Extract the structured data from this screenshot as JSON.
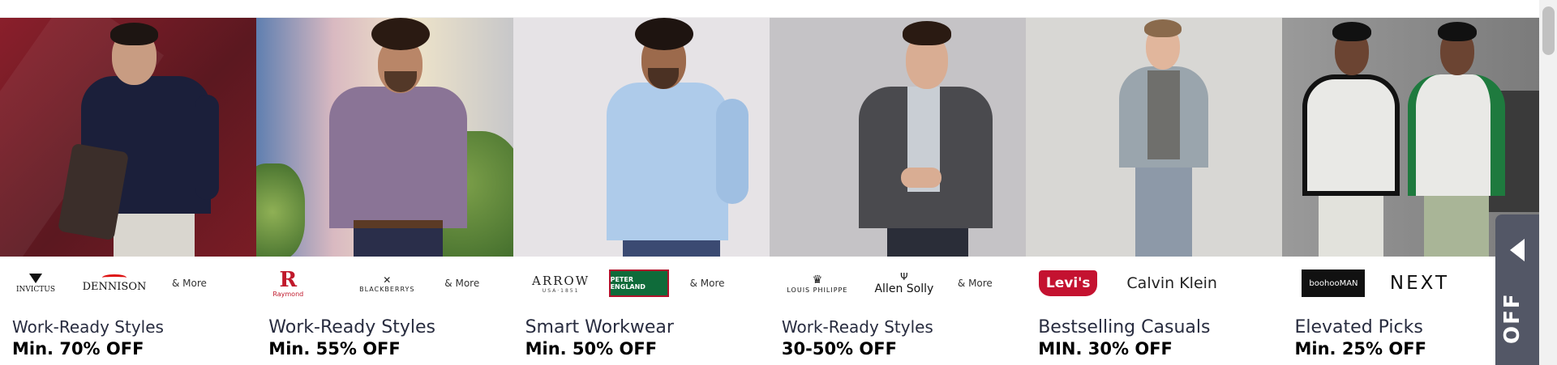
{
  "cards": [
    {
      "title": "Work-Ready Styles",
      "offer": "Min. 70% OFF",
      "brands": [
        "INVICTUS",
        "DENNISON"
      ],
      "more": "& More",
      "colors": {
        "bg": "#6e1a24",
        "shirt": "#1b1f3a",
        "pants": "#d9d6cf"
      }
    },
    {
      "title": "Work-Ready Styles",
      "offer": "Min. 55% OFF",
      "brands": [
        "Raymond",
        "BLACKBERRYS"
      ],
      "more": "& More",
      "colors": {
        "bg": "#c7b3a8",
        "shirt": "#8a7496",
        "pants": "#2a2e4a"
      }
    },
    {
      "title": "Smart Workwear",
      "offer": "Min. 50% OFF",
      "brands": [
        "ARROW",
        "PETER ENGLAND"
      ],
      "arrow_sub": "USA·1851",
      "more": "& More",
      "colors": {
        "bg": "#e6e3e6",
        "shirt": "#aecbea",
        "pants": "#3b4a72"
      }
    },
    {
      "title": "Work-Ready Styles",
      "offer": "30-50% OFF",
      "brands": [
        "LOUIS PHILIPPE",
        "Allen Solly"
      ],
      "more": "& More",
      "colors": {
        "bg": "#c5c3c6",
        "shirt": "#4a4a4e",
        "pants": "#2a2d38"
      }
    },
    {
      "title": "Bestselling Casuals",
      "offer": "MIN. 30% OFF",
      "brands": [
        "Levi's",
        "Calvin Klein"
      ],
      "colors": {
        "bg": "#d8d7d4",
        "shirt": "#9aa5ad",
        "pants": "#8d99a8"
      }
    },
    {
      "title": "Elevated Picks",
      "offer": "Min. 25% OFF",
      "brands": [
        "boohooMAN",
        "NEXT"
      ],
      "colors": {
        "bg": "#8b8b8b",
        "shirt": "#e9e9e6",
        "pants": "#e2e2dc"
      }
    }
  ],
  "side_tab": {
    "text": "OFF"
  }
}
